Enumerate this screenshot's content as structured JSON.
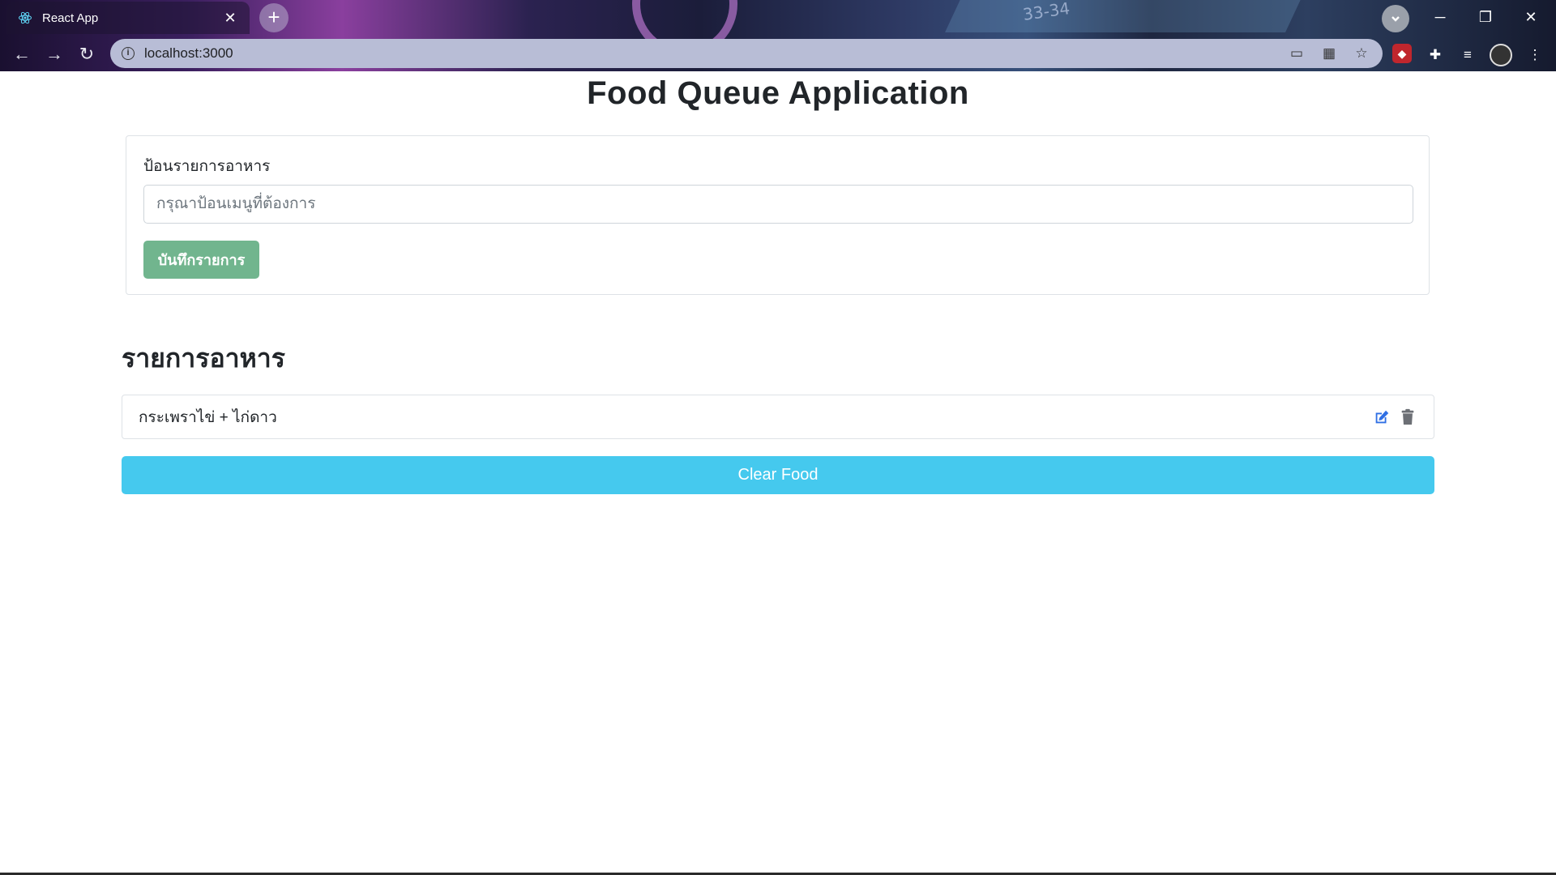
{
  "browser": {
    "tab_title": "React App",
    "tab_close": "✕",
    "new_tab": "+",
    "url": "localhost:3000",
    "deco_text": "33-34",
    "nav": {
      "back": "←",
      "forward": "→",
      "reload": "↻"
    },
    "window_controls": {
      "minimize": "─",
      "restore": "❐",
      "close": "✕"
    }
  },
  "app": {
    "title": "Food Queue Application",
    "form": {
      "label": "ป้อนรายการอาหาร",
      "placeholder": "กรุณาป้อนเมนูที่ต้องการ",
      "value": "",
      "save_label": "บันทึกรายการ"
    },
    "list_heading": "รายการอาหาร",
    "items": [
      {
        "text": "กระเพราไข่ + ไก่ดาว"
      }
    ],
    "clear_label": "Clear Food"
  },
  "colors": {
    "save_button": "#71b58e",
    "clear_button": "#45c9ee",
    "edit_icon": "#2f6fe4",
    "delete_icon": "#6c6f75"
  }
}
